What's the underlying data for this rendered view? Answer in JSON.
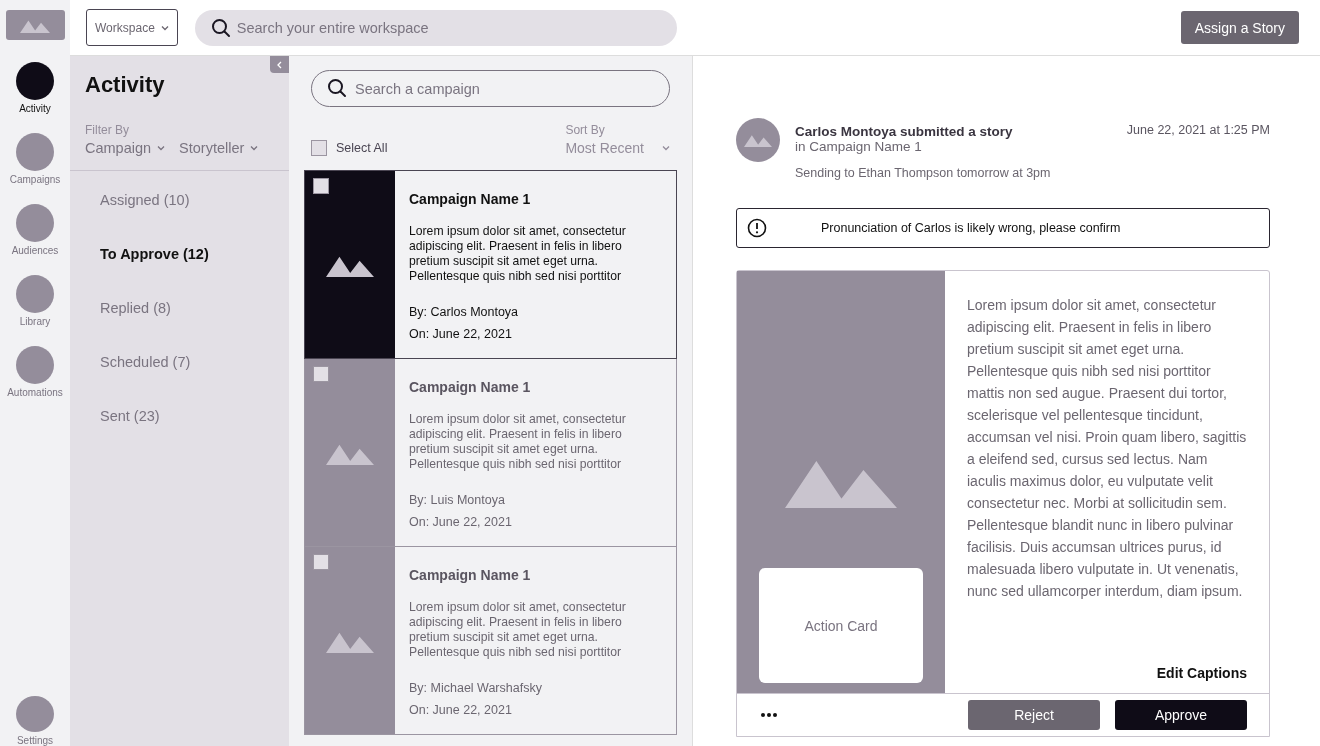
{
  "nav_items": [
    {
      "label": "Activity",
      "selected": true
    },
    {
      "label": "Campaigns",
      "selected": false
    },
    {
      "label": "Audiences",
      "selected": false
    },
    {
      "label": "Library",
      "selected": false
    },
    {
      "label": "Automations",
      "selected": false
    }
  ],
  "nav_footer": {
    "label": "Settings",
    "selected": false
  },
  "top_bar": {
    "workspace": "Workspace",
    "search_placeholder": "Search your entire workspace",
    "assign_button": "Assign a Story"
  },
  "filter_panel": {
    "title": "Activity",
    "filter_label": "Filter By",
    "filters": [
      "Campaign",
      "Storyteller"
    ],
    "items": [
      {
        "label": "Assigned (10)",
        "selected": false
      },
      {
        "label": "To Approve (12)",
        "selected": true
      },
      {
        "label": "Replied (8)",
        "selected": false
      },
      {
        "label": "Scheduled (7)",
        "selected": false
      },
      {
        "label": "Sent (23)",
        "selected": false
      }
    ]
  },
  "list": {
    "search_placeholder": "Search a campaign",
    "select_all": {
      "label": "Select All",
      "checked": false
    },
    "sort_label": "Sort By",
    "sort_value": "Most Recent",
    "stories": [
      {
        "title": "Campaign Name 1",
        "body": "Lorem ipsum dolor sit amet, consectetur adipiscing elit. Praesent in felis in libero pretium suscipit sit amet eget urna. Pellentesque quis nibh sed nisi porttitor",
        "by": "By: Carlos Montoya",
        "on": "On: June 22, 2021",
        "selected": true,
        "checked": false
      },
      {
        "title": "Campaign Name 1",
        "body": "Lorem ipsum dolor sit amet, consectetur adipiscing elit. Praesent in felis in libero pretium suscipit sit amet eget urna. Pellentesque quis nibh sed nisi porttitor",
        "by": "By: Luis Montoya",
        "on": "On: June 22, 2021",
        "selected": false,
        "checked": false
      },
      {
        "title": "Campaign Name 1",
        "body": "Lorem ipsum dolor sit amet, consectetur adipiscing elit. Praesent in felis in libero pretium suscipit sit amet eget urna. Pellentesque quis nibh sed nisi porttitor",
        "by": "By: Michael Warshafsky",
        "on": "On: June 22, 2021",
        "selected": false,
        "checked": false
      }
    ]
  },
  "detail": {
    "headline": "Carlos Montoya submitted a story",
    "campaign": "in Campaign Name 1",
    "timestamp": "June 22, 2021 at 1:25 PM",
    "schedule": "Sending to Ethan Thompson tomorrow at 3pm",
    "alert": "Pronunciation of Carlos is likely wrong, please confirm",
    "action_card": "Action Card",
    "caption": "Lorem ipsum dolor sit amet, consectetur adipiscing elit. Praesent in felis in libero pretium suscipit sit amet eget urna. Pellentesque quis nibh sed nisi porttitor mattis non sed augue. Praesent dui tortor, scelerisque vel pellentesque tincidunt, accumsan vel nisi. Proin quam libero, sagittis a eleifend sed, cursus sed lectus. Nam iaculis maximus dolor, eu vulputate velit consectetur nec. Morbi at sollicitudin sem. Pellentesque blandit nunc in libero pulvinar facilisis. Duis accumsan ultrices purus, id malesuada libero vulputate in. Ut venenatis, nunc sed ullamcorper interdum, diam ipsum.",
    "edit_captions": "Edit Captions",
    "buttons": [
      {
        "label": "Reject",
        "kind": "secondary"
      },
      {
        "label": "Approve",
        "kind": "primary"
      }
    ]
  }
}
